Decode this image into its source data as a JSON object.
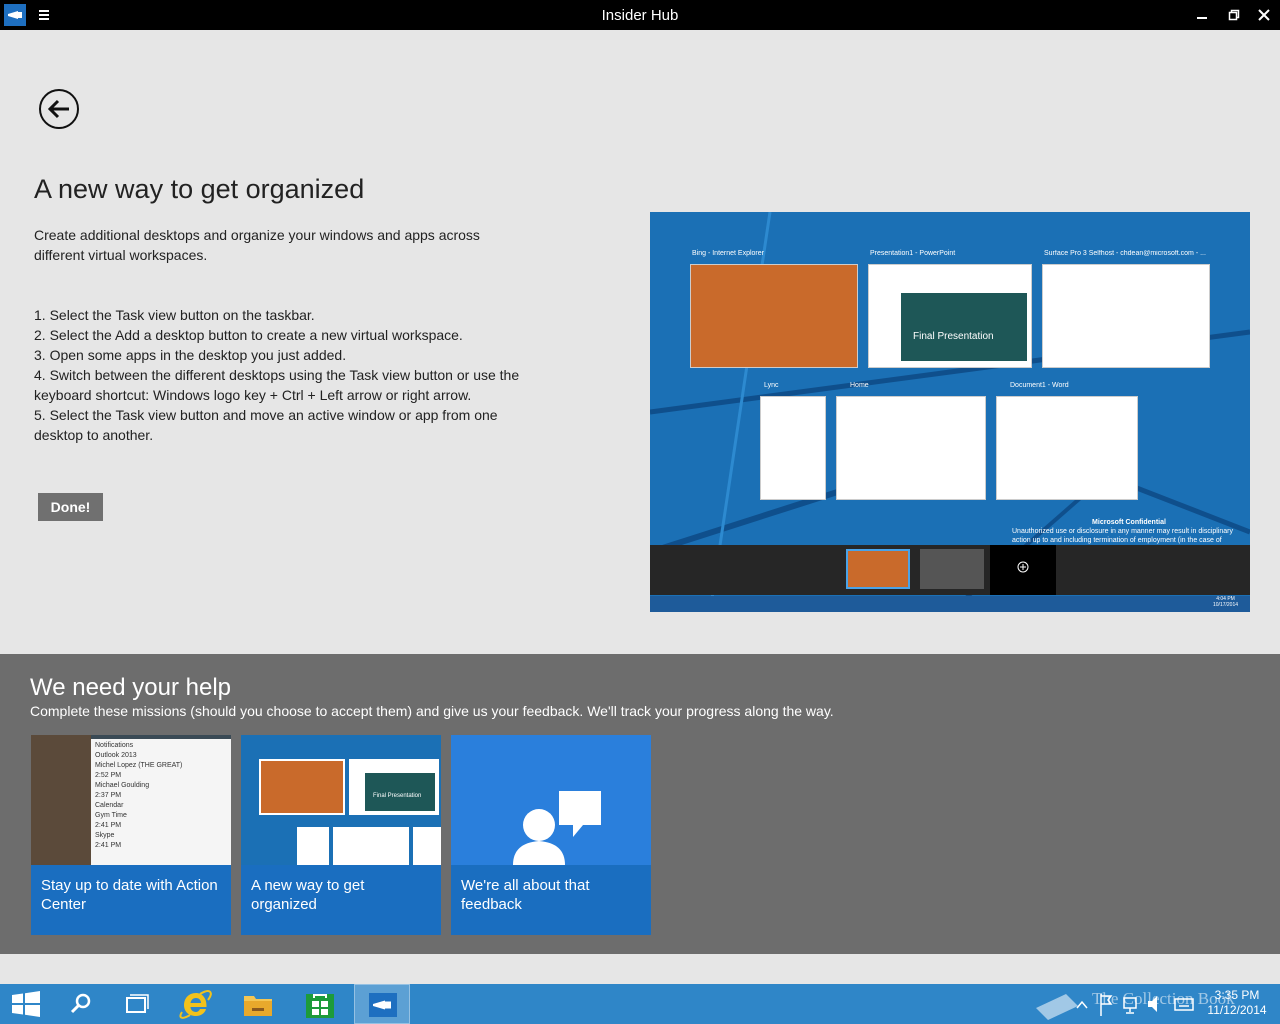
{
  "window": {
    "title": "Insider Hub"
  },
  "article": {
    "heading": "A new way to get organized",
    "intro": "Create additional desktops and organize your windows and apps across different virtual workspaces.",
    "steps": [
      "1. Select the Task view button on the taskbar.",
      "2. Select the Add a desktop button to create a new virtual workspace.",
      "3. Open some apps in the desktop you just added.",
      "4. Switch between the different desktops using the Task view button or use the keyboard shortcut: Windows logo key + Ctrl + Left arrow or right arrow.",
      "5. Select the Task view button and move an active window or app from one desktop to another."
    ],
    "done_label": "Done!"
  },
  "preview": {
    "windows": [
      "Bing - Internet Explorer",
      "Presentation1 - PowerPoint",
      "Surface Pro 3 Selfhost - chdean@microsoft.com - ...",
      "Lync",
      "Home",
      "Document1 - Word"
    ],
    "slide_text": "Final Presentation",
    "confidential_title": "Microsoft Confidential",
    "confidential_text": "Unauthorized use or disclosure in any manner may result in disciplinary action up to and including termination of employment (in the case of employees), termination of an assignment or contract (in the case of contingent staff), and",
    "tray_time": "4:04 PM",
    "tray_date": "10/17/2014"
  },
  "help": {
    "title": "We need your help",
    "subtitle": "Complete these missions (should you choose to accept them) and give us your feedback. We'll track your progress along the way.",
    "tiles": [
      {
        "label": "Stay up to date with Action Center",
        "icon": "action-center-thumbnail"
      },
      {
        "label": "A new way to get organized",
        "icon": "task-view-thumbnail"
      },
      {
        "label": "We're all about that feedback",
        "icon": "feedback-person-icon"
      }
    ],
    "thumb_notifications": "Notifications",
    "thumb_outlook": "Outlook 2013",
    "thumb_calendar": "Calendar",
    "thumb_skype": "Skype",
    "thumb_times": [
      "2:52 PM",
      "2:37 PM",
      "2:41 PM",
      "2:41 PM"
    ],
    "thumb_senders": [
      "Michel Lopez (THE GREAT)",
      "Michael Goulding",
      "Gym Time"
    ],
    "thumb_slide": "Final Presentation"
  },
  "taskbar": {
    "items": [
      "start-icon",
      "search-icon",
      "task-view-icon",
      "internet-explorer-icon",
      "file-explorer-icon",
      "store-icon",
      "insider-hub-icon"
    ],
    "time": "3:35 PM",
    "date": "11/12/2014",
    "watermark": "The Collection Book"
  },
  "colors": {
    "accent": "#1a6ec0",
    "taskbar": "#2f86c8",
    "help_band": "#6d6d6d",
    "background": "#e6e6e6"
  }
}
